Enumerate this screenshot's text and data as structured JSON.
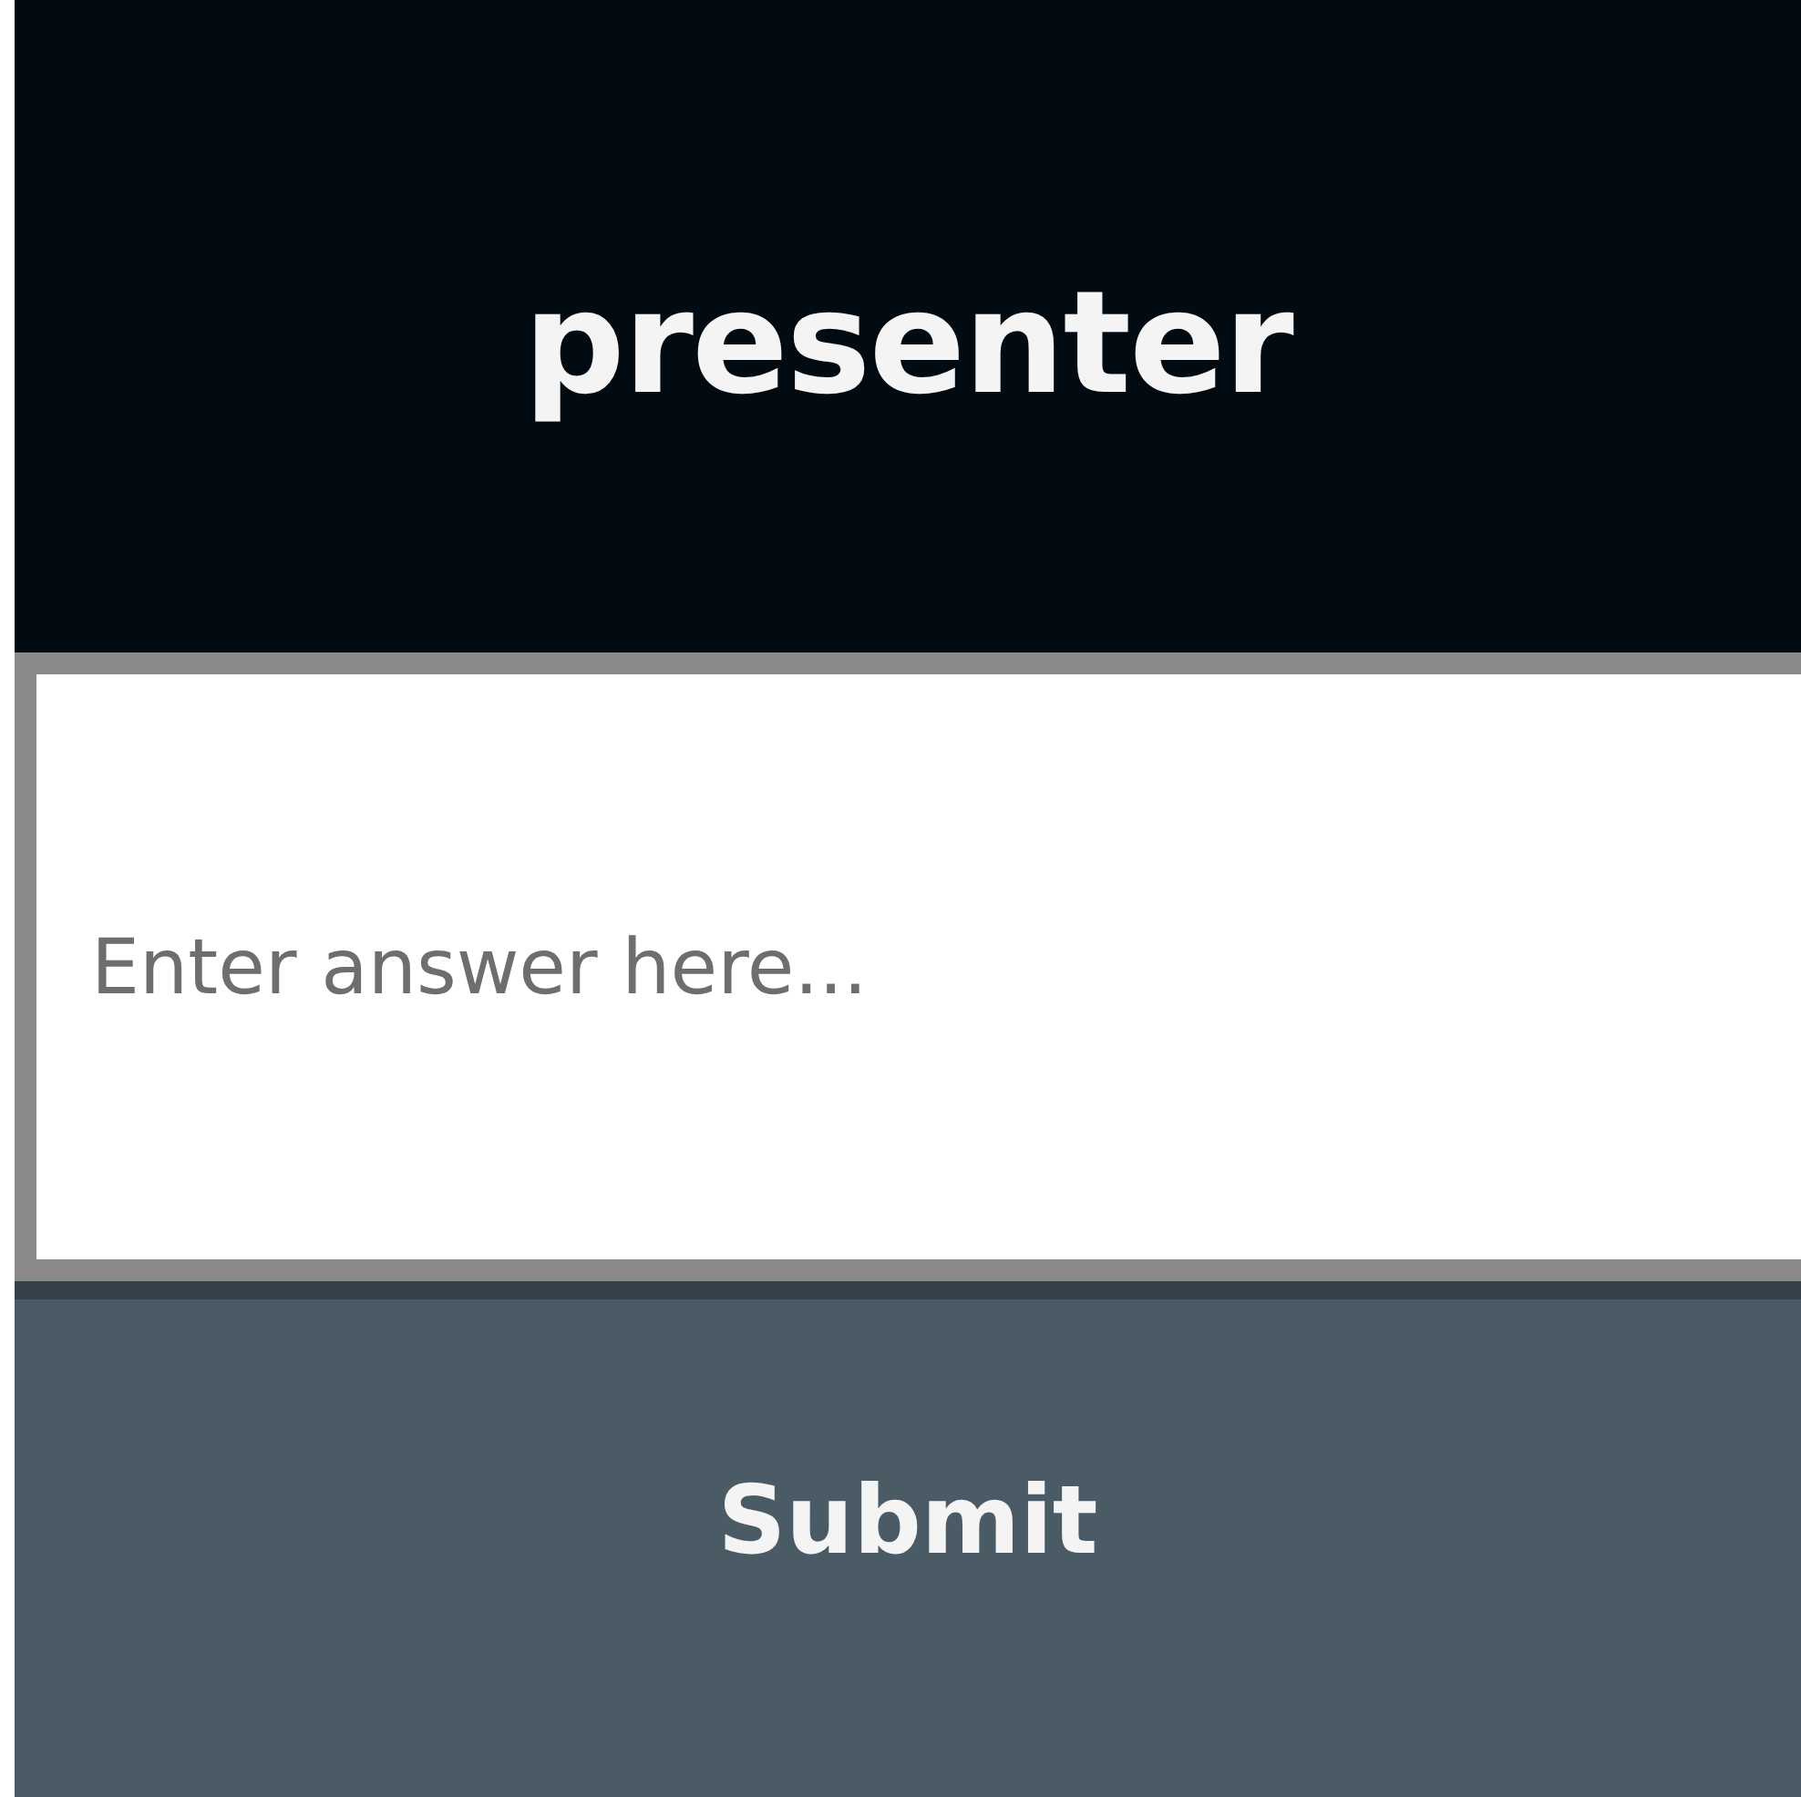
{
  "header": {
    "title": "presenter"
  },
  "answer_field": {
    "placeholder": "Enter answer here..."
  },
  "submit_button": {
    "label": "Submit"
  }
}
